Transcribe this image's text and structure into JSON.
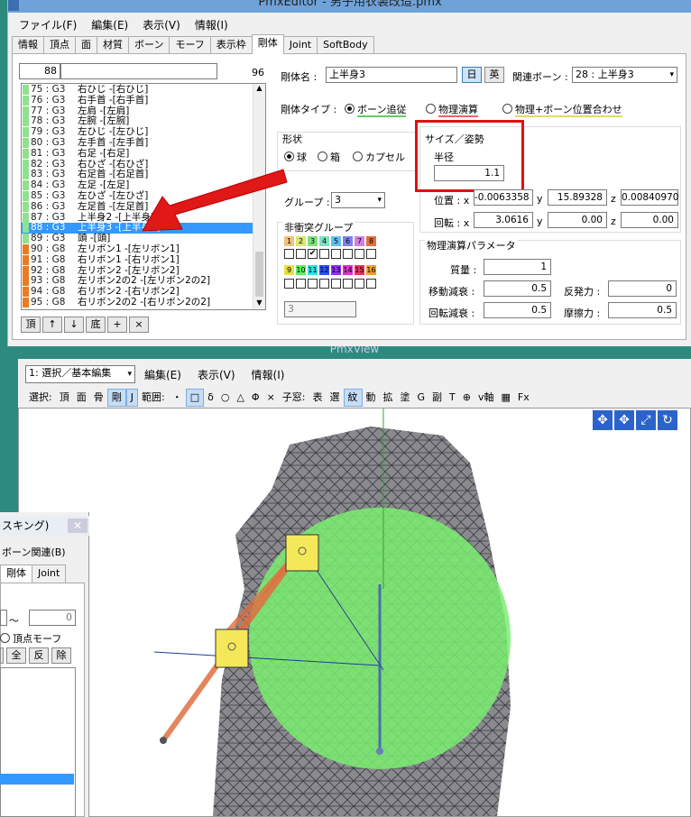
{
  "top_window": {
    "title": "PmxEditor - 男子用衣装改造.pmx",
    "menu": [
      "ファイル(F)",
      "編集(E)",
      "表示(V)",
      "情報(I)"
    ],
    "tabs": [
      "情報",
      "頂点",
      "面",
      "材質",
      "ボーン",
      "モーフ",
      "表示枠",
      "剛体",
      "Joint",
      "SoftBody"
    ],
    "selected_tab": "剛体",
    "list_index": "88",
    "list_total": "96",
    "list_items": [
      {
        "num": "75 : G3",
        "name": "右ひじ -[右ひじ]",
        "color": "#8fe08f"
      },
      {
        "num": "76 : G3",
        "name": "右手首 -[右手首]",
        "color": "#8fe08f"
      },
      {
        "num": "77 : G3",
        "name": "左肩 -[左肩]",
        "color": "#8fe08f"
      },
      {
        "num": "78 : G3",
        "name": "左腕 -[左腕]",
        "color": "#8fe08f"
      },
      {
        "num": "79 : G3",
        "name": "左ひじ -[左ひじ]",
        "color": "#8fe08f"
      },
      {
        "num": "80 : G3",
        "name": "左手首 -[左手首]",
        "color": "#8fe08f"
      },
      {
        "num": "81 : G3",
        "name": "右足 -[右足]",
        "color": "#8fe08f"
      },
      {
        "num": "82 : G3",
        "name": "右ひざ -[右ひざ]",
        "color": "#8fe08f"
      },
      {
        "num": "83 : G3",
        "name": "右足首 -[右足首]",
        "color": "#8fe08f"
      },
      {
        "num": "84 : G3",
        "name": "左足 -[左足]",
        "color": "#8fe08f"
      },
      {
        "num": "85 : G3",
        "name": "左ひざ -[左ひざ]",
        "color": "#8fe08f"
      },
      {
        "num": "86 : G3",
        "name": "左足首 -[左足首]",
        "color": "#8fe08f"
      },
      {
        "num": "87 : G3",
        "name": "上半身2 -[上半身2]",
        "color": "#8fe08f"
      },
      {
        "num": "88 : G3",
        "name": "上半身3 -[上半身3]",
        "color": "#8fe08f",
        "selected": true
      },
      {
        "num": "89 : G3",
        "name": "頭 -[頭]",
        "color": "#8fe08f"
      },
      {
        "num": "90 : G8",
        "name": "左リボン1 -[左リボン1]",
        "color": "#ee7a20"
      },
      {
        "num": "91 : G8",
        "name": "右リボン1 -[右リボン1]",
        "color": "#ee7a20"
      },
      {
        "num": "92 : G8",
        "name": "左リボン2 -[左リボン2]",
        "color": "#ee7a20"
      },
      {
        "num": "93 : G8",
        "name": "左リボン2の2 -[左リボン2の2]",
        "color": "#ee7a20"
      },
      {
        "num": "94 : G8",
        "name": "右リボン2 -[右リボン2]",
        "color": "#ee7a20"
      },
      {
        "num": "95 : G8",
        "name": "右リボン2の2 -[右リボン2の2]",
        "color": "#ee7a20"
      }
    ],
    "list_buttons": [
      "頂",
      "↑",
      "↓",
      "底",
      "+",
      "×"
    ],
    "rigid_name_label": "剛体名 :",
    "rigid_name": "上半身3",
    "btn_jp": "日",
    "btn_en": "英",
    "related_bone_label": "関連ボーン :",
    "related_bone": "28 : 上半身3",
    "type_label": "剛体タイプ :",
    "types": [
      "ボーン追従",
      "物理演算",
      "物理+ボーン位置合わせ"
    ],
    "shape_label": "形状",
    "shapes": [
      "球",
      "箱",
      "カプセル"
    ],
    "size_label": "サイズ／姿勢",
    "radius_label": "半径",
    "radius": "1.1",
    "pos_label": "位置 : x",
    "pos": [
      "-0.0063358",
      "15.89328",
      "0.00840970"
    ],
    "rot_label": "回転 : x",
    "rot": [
      "3.0616",
      "0.00",
      "0.00"
    ],
    "axis_y": "y",
    "axis_z": "z",
    "group_label": "グループ :",
    "group": "3",
    "nocol_label": "非衝突グループ",
    "nocol_row1": [
      {
        "n": "1",
        "c": "#f2c080"
      },
      {
        "n": "2",
        "c": "#d8e870"
      },
      {
        "n": "3",
        "c": "#80e080"
      },
      {
        "n": "4",
        "c": "#80e0c0"
      },
      {
        "n": "5",
        "c": "#60c0f0"
      },
      {
        "n": "6",
        "c": "#8080f0"
      },
      {
        "n": "7",
        "c": "#d080e0"
      },
      {
        "n": "8",
        "c": "#e07040"
      }
    ],
    "nocol_row2": [
      {
        "n": "9",
        "c": "#e8e040"
      },
      {
        "n": "10",
        "c": "#60f060"
      },
      {
        "n": "11",
        "c": "#30e0e0"
      },
      {
        "n": "12",
        "c": "#3050f0"
      },
      {
        "n": "13",
        "c": "#9030f0"
      },
      {
        "n": "14",
        "c": "#e030d0"
      },
      {
        "n": "15",
        "c": "#f03060"
      },
      {
        "n": "16",
        "c": "#f0a030"
      }
    ],
    "nocol_mask": "3",
    "phys_label": "物理演算パラメータ",
    "mass_label": "質量 :",
    "mass": "1",
    "lin_damp_label": "移動減衰 :",
    "lin_damp": "0.5",
    "ang_damp_label": "回転減衰 :",
    "ang_damp": "0.5",
    "restitution_label": "反発力 :",
    "restitution": "0",
    "friction_label": "摩擦力 :",
    "friction": "0.5"
  },
  "view_window": {
    "title": "PmxView",
    "mode": "1: 選択／基本編集",
    "menu": [
      "編集(E)",
      "表示(V)",
      "情報(I)"
    ],
    "tools": [
      "選択:",
      "頂",
      "面",
      "骨",
      "剛",
      "J",
      "範囲:",
      "・",
      "□",
      "δ",
      "○",
      "△",
      "Φ",
      "×",
      "子窓:",
      "表",
      "選",
      "紋",
      "動",
      "拡",
      "塗",
      "G",
      "副",
      "T",
      "⊕",
      "v軸",
      "▦",
      "Fx"
    ]
  },
  "left_window": {
    "title": "スキング)",
    "menu": "ボーン関連(B)",
    "tabs": [
      "剛体",
      "Joint"
    ],
    "range_sep": "〜",
    "range_val": "0",
    "vmorph": "頂点モーフ",
    "btns": [
      "全",
      "反",
      "除"
    ]
  }
}
